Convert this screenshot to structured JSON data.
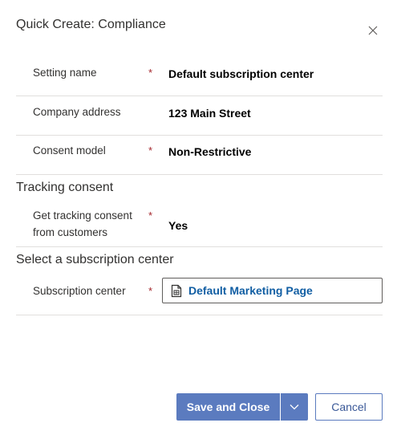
{
  "dialog": {
    "title": "Quick Create: Compliance",
    "close_icon": "close-icon"
  },
  "fields": {
    "setting_name": {
      "label": "Setting name",
      "required": "*",
      "value": "Default subscription center"
    },
    "company_address": {
      "label": "Company address",
      "value": "123 Main Street"
    },
    "consent_model": {
      "label": "Consent model",
      "required": "*",
      "value": "Non-Restrictive"
    }
  },
  "tracking": {
    "heading": "Tracking consent",
    "label_line1": "Get tracking consent",
    "label_line2": "from customers",
    "required": "*",
    "value": "Yes"
  },
  "subscription": {
    "heading": "Select a subscription center",
    "label": "Subscription center",
    "required": "*",
    "lookup_value": "Default Marketing Page",
    "lookup_icon": "document-icon"
  },
  "footer": {
    "save_label": "Save and Close",
    "dropdown_icon": "chevron-down-icon",
    "cancel_label": "Cancel"
  },
  "colors": {
    "required": "#a4262c",
    "primary_button": "#5b7bbf",
    "link": "#115ea3",
    "divider": "#e1dfdd"
  }
}
